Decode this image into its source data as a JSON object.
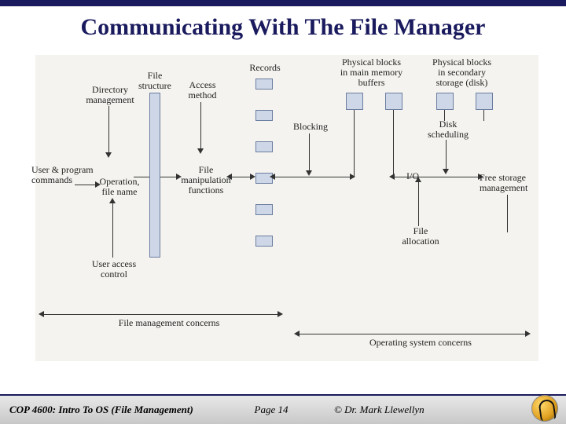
{
  "title": "Communicating With The File Manager",
  "diagram": {
    "labels": {
      "directory_mgmt": "Directory\nmanagement",
      "file_structure": "File\nstructure",
      "access_method": "Access\nmethod",
      "records": "Records",
      "blocking": "Blocking",
      "phys_main": "Physical blocks\nin main memory\nbuffers",
      "phys_sec": "Physical blocks\nin secondary\nstorage (disk)",
      "disk_sched": "Disk\nscheduling",
      "user_cmds": "User & program\ncommands",
      "op_fname": "Operation,\nfile name",
      "file_manip": "File\nmanipulation\nfunctions",
      "io": "I/O",
      "free_storage": "Free storage\nmanagement",
      "file_alloc": "File\nallocation",
      "user_access": "User access\ncontrol",
      "fm_concerns": "File management concerns",
      "os_concerns": "Operating system concerns"
    }
  },
  "footer": {
    "course": "COP 4600: Intro To OS  (File Management)",
    "page": "Page 14",
    "copyright": "© Dr. Mark Llewellyn"
  }
}
